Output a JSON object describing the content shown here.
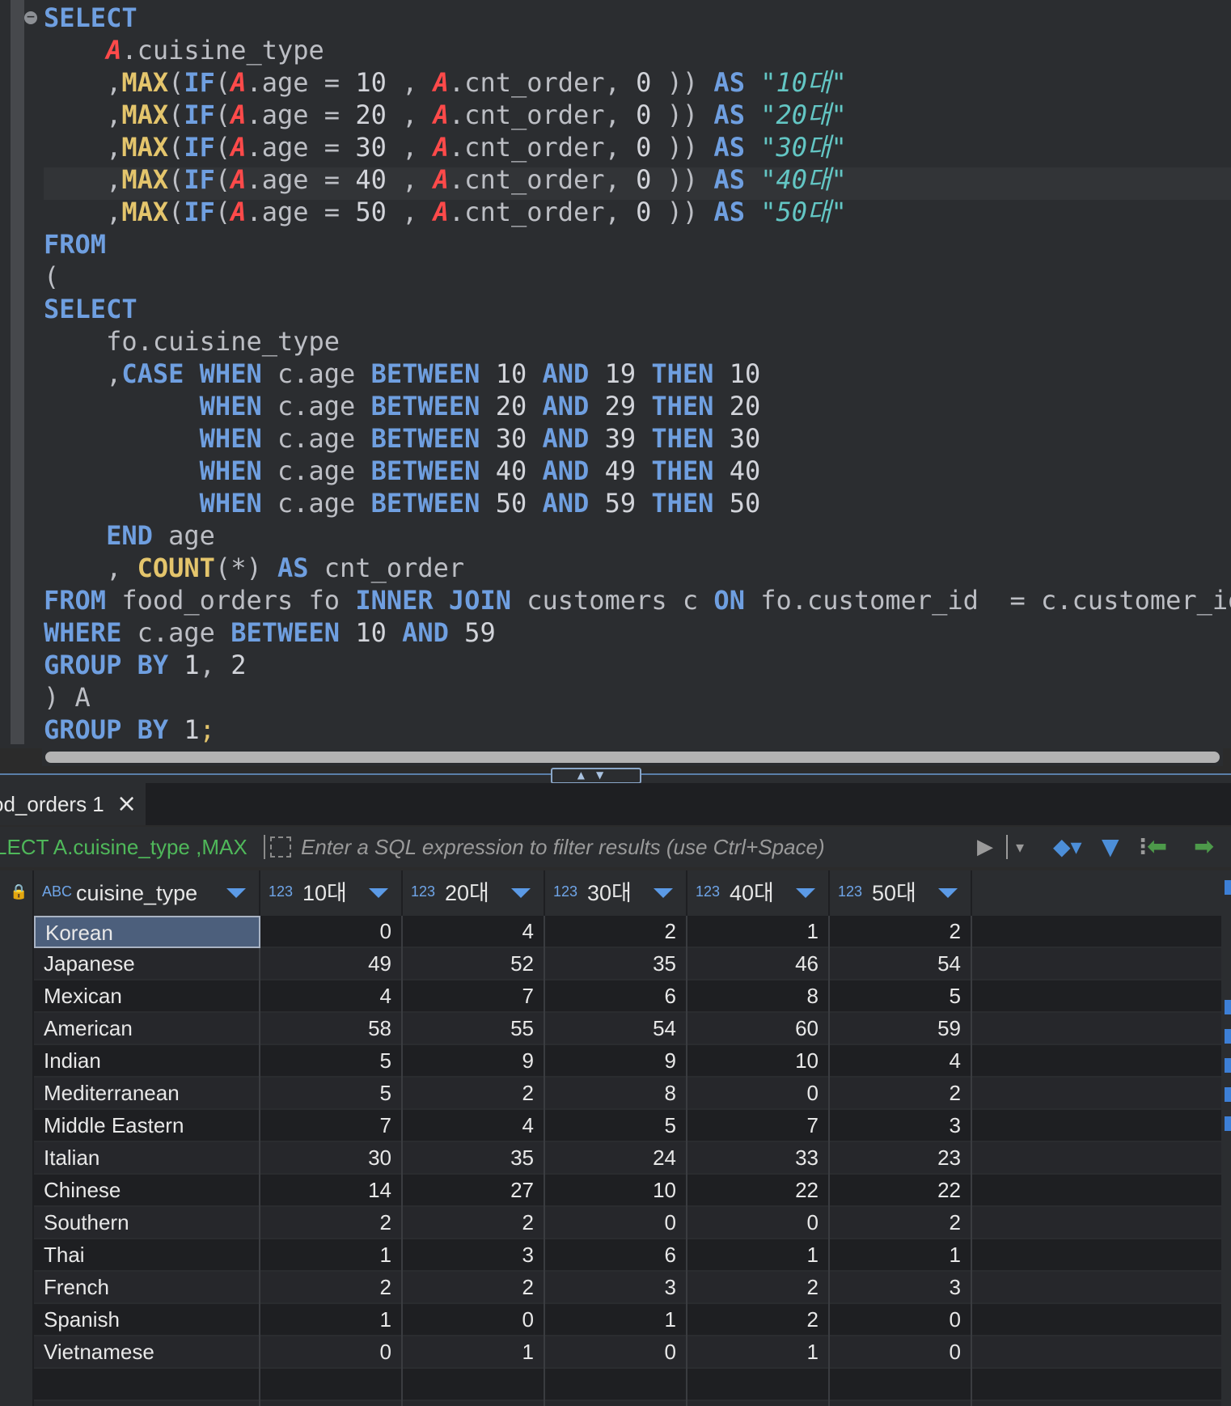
{
  "editor": {
    "lines": [
      [
        [
          "kw",
          "SELECT"
        ]
      ],
      [
        [
          "t",
          "    "
        ],
        [
          "al",
          "A"
        ],
        [
          "t",
          ".cuisine_type"
        ]
      ],
      [
        [
          "t",
          "    ,"
        ],
        [
          "fn",
          "MAX"
        ],
        [
          "t",
          "("
        ],
        [
          "kw",
          "IF"
        ],
        [
          "t",
          "("
        ],
        [
          "al",
          "A"
        ],
        [
          "t",
          ".age = "
        ],
        [
          "num",
          "10"
        ],
        [
          "t",
          " , "
        ],
        [
          "al",
          "A"
        ],
        [
          "t",
          ".cnt_order, "
        ],
        [
          "num",
          "0"
        ],
        [
          "t",
          " )) "
        ],
        [
          "kw",
          "AS"
        ],
        [
          "t",
          " "
        ],
        [
          "str",
          "\"10대\""
        ]
      ],
      [
        [
          "t",
          "    ,"
        ],
        [
          "fn",
          "MAX"
        ],
        [
          "t",
          "("
        ],
        [
          "kw",
          "IF"
        ],
        [
          "t",
          "("
        ],
        [
          "al",
          "A"
        ],
        [
          "t",
          ".age = "
        ],
        [
          "num",
          "20"
        ],
        [
          "t",
          " , "
        ],
        [
          "al",
          "A"
        ],
        [
          "t",
          ".cnt_order, "
        ],
        [
          "num",
          "0"
        ],
        [
          "t",
          " )) "
        ],
        [
          "kw",
          "AS"
        ],
        [
          "t",
          " "
        ],
        [
          "str",
          "\"20대\""
        ]
      ],
      [
        [
          "t",
          "    ,"
        ],
        [
          "fn",
          "MAX"
        ],
        [
          "t",
          "("
        ],
        [
          "kw",
          "IF"
        ],
        [
          "t",
          "("
        ],
        [
          "al",
          "A"
        ],
        [
          "t",
          ".age = "
        ],
        [
          "num",
          "30"
        ],
        [
          "t",
          " , "
        ],
        [
          "al",
          "A"
        ],
        [
          "t",
          ".cnt_order, "
        ],
        [
          "num",
          "0"
        ],
        [
          "t",
          " )) "
        ],
        [
          "kw",
          "AS"
        ],
        [
          "t",
          " "
        ],
        [
          "str",
          "\"30대\""
        ]
      ],
      [
        [
          "t",
          "    ,"
        ],
        [
          "fn",
          "MAX"
        ],
        [
          "t",
          "("
        ],
        [
          "kw",
          "IF"
        ],
        [
          "t",
          "("
        ],
        [
          "al",
          "A"
        ],
        [
          "t",
          ".age = "
        ],
        [
          "num",
          "40"
        ],
        [
          "t",
          " , "
        ],
        [
          "al",
          "A"
        ],
        [
          "t",
          ".cnt_order, "
        ],
        [
          "num",
          "0"
        ],
        [
          "t",
          " )) "
        ],
        [
          "kw",
          "AS"
        ],
        [
          "t",
          " "
        ],
        [
          "str",
          "\"40대\""
        ]
      ],
      [
        [
          "t",
          "    ,"
        ],
        [
          "fn",
          "MAX"
        ],
        [
          "t",
          "("
        ],
        [
          "kw",
          "IF"
        ],
        [
          "t",
          "("
        ],
        [
          "al",
          "A"
        ],
        [
          "t",
          ".age = "
        ],
        [
          "num",
          "50"
        ],
        [
          "t",
          " , "
        ],
        [
          "al",
          "A"
        ],
        [
          "t",
          ".cnt_order, "
        ],
        [
          "num",
          "0"
        ],
        [
          "t",
          " )) "
        ],
        [
          "kw",
          "AS"
        ],
        [
          "t",
          " "
        ],
        [
          "str",
          "\"50대\""
        ]
      ],
      [
        [
          "kw",
          "FROM"
        ]
      ],
      [
        [
          "t",
          "("
        ]
      ],
      [
        [
          "kw",
          "SELECT"
        ]
      ],
      [
        [
          "t",
          "    fo.cuisine_type"
        ]
      ],
      [
        [
          "t",
          "    ,"
        ],
        [
          "kw",
          "CASE"
        ],
        [
          "t",
          " "
        ],
        [
          "kw",
          "WHEN"
        ],
        [
          "t",
          " c.age "
        ],
        [
          "kw",
          "BETWEEN"
        ],
        [
          "t",
          " "
        ],
        [
          "num",
          "10"
        ],
        [
          "t",
          " "
        ],
        [
          "kw",
          "AND"
        ],
        [
          "t",
          " "
        ],
        [
          "num",
          "19"
        ],
        [
          "t",
          " "
        ],
        [
          "kw",
          "THEN"
        ],
        [
          "t",
          " "
        ],
        [
          "num",
          "10"
        ]
      ],
      [
        [
          "t",
          "          "
        ],
        [
          "kw",
          "WHEN"
        ],
        [
          "t",
          " c.age "
        ],
        [
          "kw",
          "BETWEEN"
        ],
        [
          "t",
          " "
        ],
        [
          "num",
          "20"
        ],
        [
          "t",
          " "
        ],
        [
          "kw",
          "AND"
        ],
        [
          "t",
          " "
        ],
        [
          "num",
          "29"
        ],
        [
          "t",
          " "
        ],
        [
          "kw",
          "THEN"
        ],
        [
          "t",
          " "
        ],
        [
          "num",
          "20"
        ]
      ],
      [
        [
          "t",
          "          "
        ],
        [
          "kw",
          "WHEN"
        ],
        [
          "t",
          " c.age "
        ],
        [
          "kw",
          "BETWEEN"
        ],
        [
          "t",
          " "
        ],
        [
          "num",
          "30"
        ],
        [
          "t",
          " "
        ],
        [
          "kw",
          "AND"
        ],
        [
          "t",
          " "
        ],
        [
          "num",
          "39"
        ],
        [
          "t",
          " "
        ],
        [
          "kw",
          "THEN"
        ],
        [
          "t",
          " "
        ],
        [
          "num",
          "30"
        ]
      ],
      [
        [
          "t",
          "          "
        ],
        [
          "kw",
          "WHEN"
        ],
        [
          "t",
          " c.age "
        ],
        [
          "kw",
          "BETWEEN"
        ],
        [
          "t",
          " "
        ],
        [
          "num",
          "40"
        ],
        [
          "t",
          " "
        ],
        [
          "kw",
          "AND"
        ],
        [
          "t",
          " "
        ],
        [
          "num",
          "49"
        ],
        [
          "t",
          " "
        ],
        [
          "kw",
          "THEN"
        ],
        [
          "t",
          " "
        ],
        [
          "num",
          "40"
        ]
      ],
      [
        [
          "t",
          "          "
        ],
        [
          "kw",
          "WHEN"
        ],
        [
          "t",
          " c.age "
        ],
        [
          "kw",
          "BETWEEN"
        ],
        [
          "t",
          " "
        ],
        [
          "num",
          "50"
        ],
        [
          "t",
          " "
        ],
        [
          "kw",
          "AND"
        ],
        [
          "t",
          " "
        ],
        [
          "num",
          "59"
        ],
        [
          "t",
          " "
        ],
        [
          "kw",
          "THEN"
        ],
        [
          "t",
          " "
        ],
        [
          "num",
          "50"
        ]
      ],
      [
        [
          "t",
          "    "
        ],
        [
          "kw",
          "END"
        ],
        [
          "t",
          " age"
        ]
      ],
      [
        [
          "t",
          "    , "
        ],
        [
          "fn",
          "COUNT"
        ],
        [
          "t",
          "(*) "
        ],
        [
          "kw",
          "AS"
        ],
        [
          "t",
          " cnt_order"
        ]
      ],
      [
        [
          "kw",
          "FROM"
        ],
        [
          "t",
          " food_orders fo "
        ],
        [
          "kw",
          "INNER JOIN"
        ],
        [
          "t",
          " customers c "
        ],
        [
          "kw",
          "ON"
        ],
        [
          "t",
          " fo.customer_id  = c.customer_id"
        ]
      ],
      [
        [
          "kw",
          "WHERE"
        ],
        [
          "t",
          " c.age "
        ],
        [
          "kw",
          "BETWEEN"
        ],
        [
          "t",
          " "
        ],
        [
          "num",
          "10"
        ],
        [
          "t",
          " "
        ],
        [
          "kw",
          "AND"
        ],
        [
          "t",
          " "
        ],
        [
          "num",
          "59"
        ]
      ],
      [
        [
          "kw",
          "GROUP BY"
        ],
        [
          "t",
          " "
        ],
        [
          "num",
          "1"
        ],
        [
          "t",
          ", "
        ],
        [
          "num",
          "2"
        ]
      ],
      [
        [
          "t",
          ") A"
        ]
      ],
      [
        [
          "kw",
          "GROUP BY"
        ],
        [
          "t",
          " "
        ],
        [
          "num",
          "1"
        ],
        [
          "semi",
          ";"
        ]
      ]
    ]
  },
  "results": {
    "tab_label": "od_orders 1",
    "query_preview": "LECT A.cuisine_type ,MAX",
    "filter_placeholder": "Enter a SQL expression to filter results (use Ctrl+Space)",
    "columns": [
      {
        "type": "ABC",
        "label": "cuisine_type"
      },
      {
        "type": "123",
        "label": "10대"
      },
      {
        "type": "123",
        "label": "20대"
      },
      {
        "type": "123",
        "label": "30대"
      },
      {
        "type": "123",
        "label": "40대"
      },
      {
        "type": "123",
        "label": "50대"
      }
    ],
    "rows": [
      [
        "Korean",
        "0",
        "4",
        "2",
        "1",
        "2"
      ],
      [
        "Japanese",
        "49",
        "52",
        "35",
        "46",
        "54"
      ],
      [
        "Mexican",
        "4",
        "7",
        "6",
        "8",
        "5"
      ],
      [
        "American",
        "58",
        "55",
        "54",
        "60",
        "59"
      ],
      [
        "Indian",
        "5",
        "9",
        "9",
        "10",
        "4"
      ],
      [
        "Mediterranean",
        "5",
        "2",
        "8",
        "0",
        "2"
      ],
      [
        "Middle Eastern",
        "7",
        "4",
        "5",
        "7",
        "3"
      ],
      [
        "Italian",
        "30",
        "35",
        "24",
        "33",
        "23"
      ],
      [
        "Chinese",
        "14",
        "27",
        "10",
        "22",
        "22"
      ],
      [
        "Southern",
        "2",
        "2",
        "0",
        "0",
        "2"
      ],
      [
        "Thai",
        "1",
        "3",
        "6",
        "1",
        "1"
      ],
      [
        "French",
        "2",
        "2",
        "3",
        "2",
        "3"
      ],
      [
        "Spanish",
        "1",
        "0",
        "1",
        "2",
        "0"
      ],
      [
        "Vietnamese",
        "0",
        "1",
        "0",
        "1",
        "0"
      ]
    ]
  }
}
